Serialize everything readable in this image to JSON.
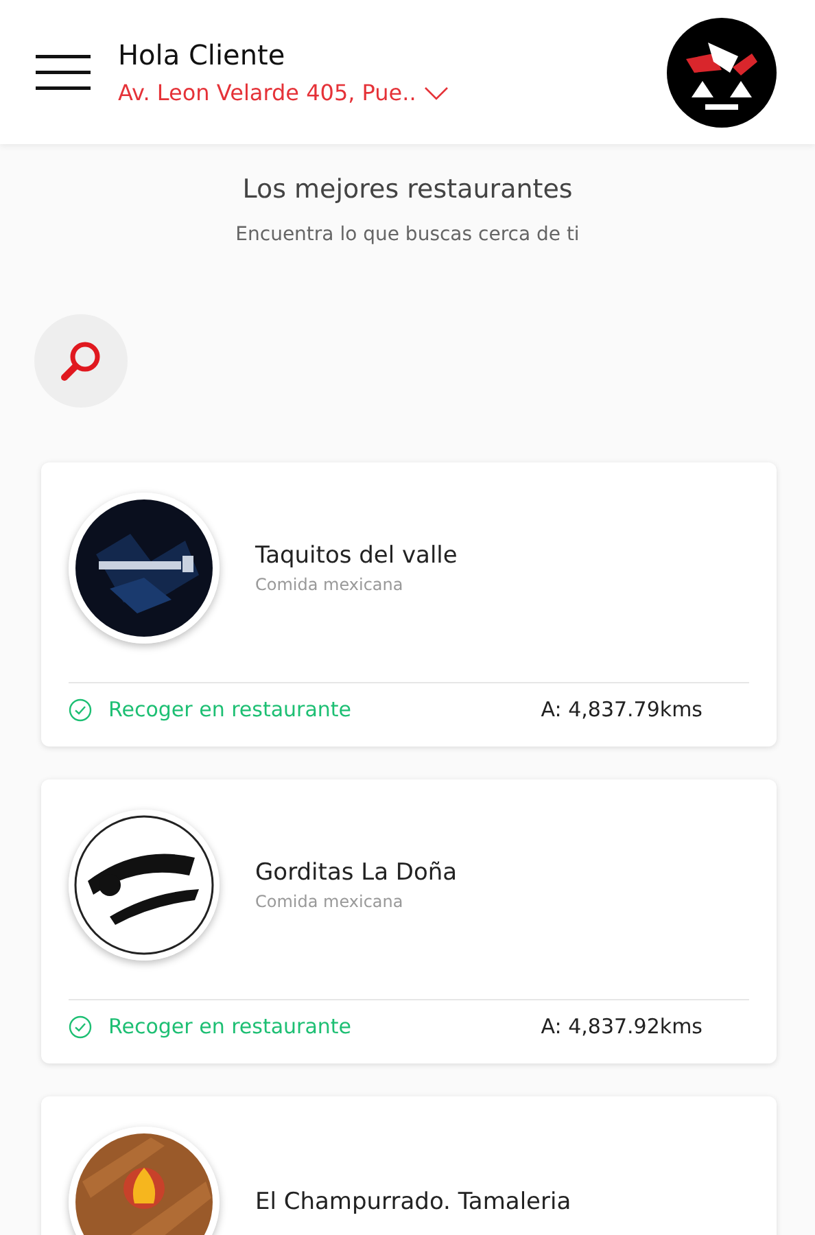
{
  "header": {
    "greeting": "Hola Cliente",
    "address": "Av. Leon Velarde 405, Pue.."
  },
  "intro": {
    "title": "Los mejores restaurantes",
    "subtitle": "Encuentra lo que buscas cerca de ti"
  },
  "restaurants": [
    {
      "name": "Taquitos del valle",
      "category": "Comida mexicana",
      "pickup": "Recoger en restaurante",
      "distance": "A: 4,837.79kms"
    },
    {
      "name": "Gorditas La Doña",
      "category": "Comida mexicana",
      "pickup": "Recoger en restaurante",
      "distance": "A: 4,837.92kms"
    },
    {
      "name": "El Champurrado. Tamaleria"
    }
  ]
}
